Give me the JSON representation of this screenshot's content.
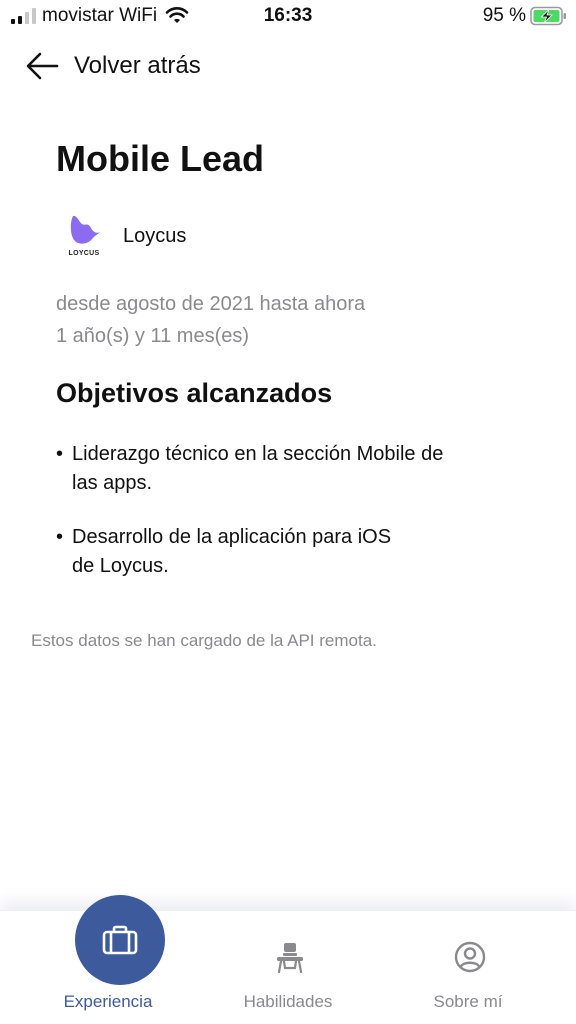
{
  "status_bar": {
    "carrier": "movistar WiFi",
    "time": "16:33",
    "battery_percent": "95 %",
    "icons": [
      "signal-icon",
      "wifi-icon",
      "battery-charging-icon"
    ]
  },
  "header": {
    "back_label": "Volver atrás",
    "back_icon": "arrow-left-icon"
  },
  "job": {
    "title": "Mobile Lead",
    "company_name": "Loycus",
    "company_logo_text": "LOYCUS",
    "dates": "desde agosto de 2021 hasta ahora",
    "duration": "1 año(s) y 11 mes(es)"
  },
  "achievements": {
    "title": "Objetivos alcanzados",
    "bullet": "•",
    "items": [
      [
        "Liderazgo técnico en la sección Mobile de",
        "las apps."
      ],
      [
        "Desarrollo de la aplicación para iOS",
        "de Loycus."
      ]
    ]
  },
  "footnote": "Estos datos se han cargado de la API remota.",
  "tabbar": {
    "tabs": [
      {
        "label": "Experiencia",
        "icon": "briefcase-icon",
        "active": true
      },
      {
        "label": "Habilidades",
        "icon": "desk-chair-icon",
        "active": false
      },
      {
        "label": "Sobre mí",
        "icon": "user-circle-icon",
        "active": false
      }
    ]
  },
  "colors": {
    "accent": "#3d5a9c",
    "secondary_text": "#8a8a8e",
    "logo": "#8b6cf0",
    "battery_charging": "#4cd964"
  }
}
